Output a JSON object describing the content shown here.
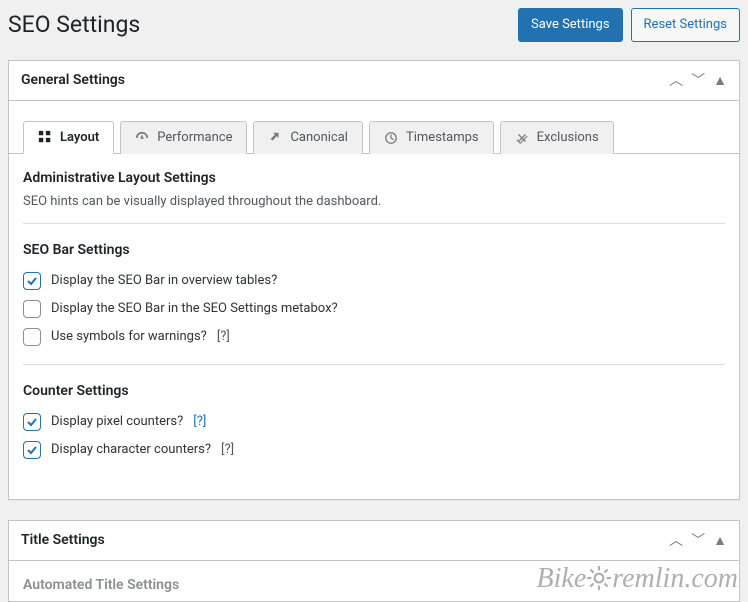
{
  "page": {
    "title": "SEO Settings",
    "save_label": "Save Settings",
    "reset_label": "Reset Settings"
  },
  "panel1": {
    "title": "General Settings",
    "tabs": [
      {
        "label": "Layout"
      },
      {
        "label": "Performance"
      },
      {
        "label": "Canonical"
      },
      {
        "label": "Timestamps"
      },
      {
        "label": "Exclusions"
      }
    ],
    "admin_layout": {
      "heading": "Administrative Layout Settings",
      "desc": "SEO hints can be visually displayed throughout the dashboard."
    },
    "seobar": {
      "heading": "SEO Bar Settings",
      "opt1": "Display the SEO Bar in overview tables?",
      "opt2": "Display the SEO Bar in the SEO Settings metabox?",
      "opt3": "Use symbols for warnings?",
      "opt3_help": "[?]"
    },
    "counter": {
      "heading": "Counter Settings",
      "opt1": "Display pixel counters?",
      "opt1_help": "[?]",
      "opt2": "Display character counters?",
      "opt2_help": "[?]"
    }
  },
  "panel2": {
    "title": "Title Settings",
    "auto_heading": "Automated Title Settings"
  },
  "watermark": {
    "brand1": "Bike",
    "brand2": "remlin",
    "tld": ".com"
  }
}
